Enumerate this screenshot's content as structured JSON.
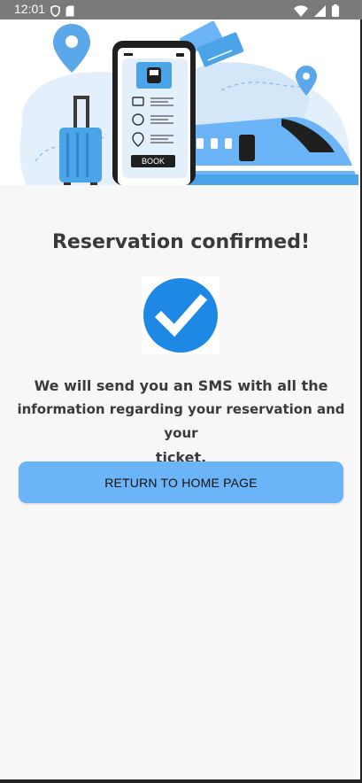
{
  "status_bar": {
    "time": "12:01",
    "left_icons": [
      "shield-icon",
      "sd-card-icon"
    ],
    "right_icons": [
      "wifi-icon",
      "signal-icon",
      "battery-icon"
    ],
    "background": "#7a7a7a"
  },
  "hero": {
    "book_label": "BOOK"
  },
  "confirmation": {
    "title": "Reservation confirmed!",
    "message_line1": "We will send you an SMS with all the",
    "message_line2": "information regarding your reservation and your",
    "message_line3": "ticket.",
    "return_button_label": "RETURN TO HOME PAGE"
  },
  "colors": {
    "accent": "#6ab4f7",
    "check_circle": "#1e88e5",
    "title_text": "#3a3a3a"
  }
}
